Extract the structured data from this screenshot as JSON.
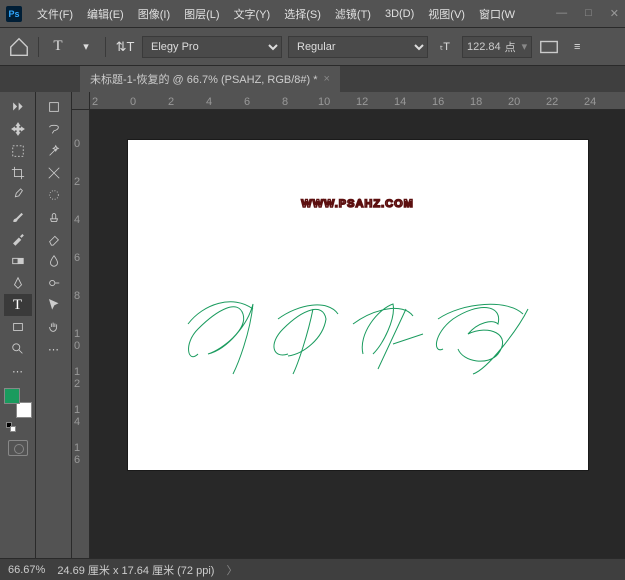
{
  "app": {
    "logo": "Ps"
  },
  "menu": {
    "file": "文件(F)",
    "edit": "编辑(E)",
    "image": "图像(I)",
    "layer": "图层(L)",
    "type": "文字(Y)",
    "select": "选择(S)",
    "filter": "滤镜(T)",
    "three_d": "3D(D)",
    "view": "视图(V)",
    "window": "窗口(W"
  },
  "win": {
    "min": "—",
    "max": "□",
    "close": "✕"
  },
  "options": {
    "font": "Elegy Pro",
    "style": "Regular",
    "size_value": "122.84",
    "size_unit": "点"
  },
  "tab": {
    "title": "未标题-1-恢复的 @ 66.7% (PSAHZ, RGB/8#) *"
  },
  "ruler_h": {
    "n2": "2",
    "n0": "0",
    "p2": "2",
    "p4": "4",
    "p6": "6",
    "p8": "8",
    "p10": "10",
    "p12": "12",
    "p14": "14",
    "p16": "16",
    "p18": "18",
    "p20": "20",
    "p22": "22",
    "p24": "24"
  },
  "ruler_v": {
    "r0": "0",
    "r2": "2",
    "r4": "4",
    "r6": "6",
    "r8": "8",
    "r10": "1\n0",
    "r12": "1\n2",
    "r14": "1\n4",
    "r16": "1\n6"
  },
  "canvas": {
    "watermark": "WWW.PSAHZ.COM",
    "script_text": "PSAHZ"
  },
  "colors": {
    "foreground": "#1a9b5e",
    "background": "#ffffff"
  },
  "status": {
    "zoom": "66.67%",
    "dims": "24.69 厘米 x 17.64 厘米 (72 ppi)",
    "arrow": "〉"
  }
}
